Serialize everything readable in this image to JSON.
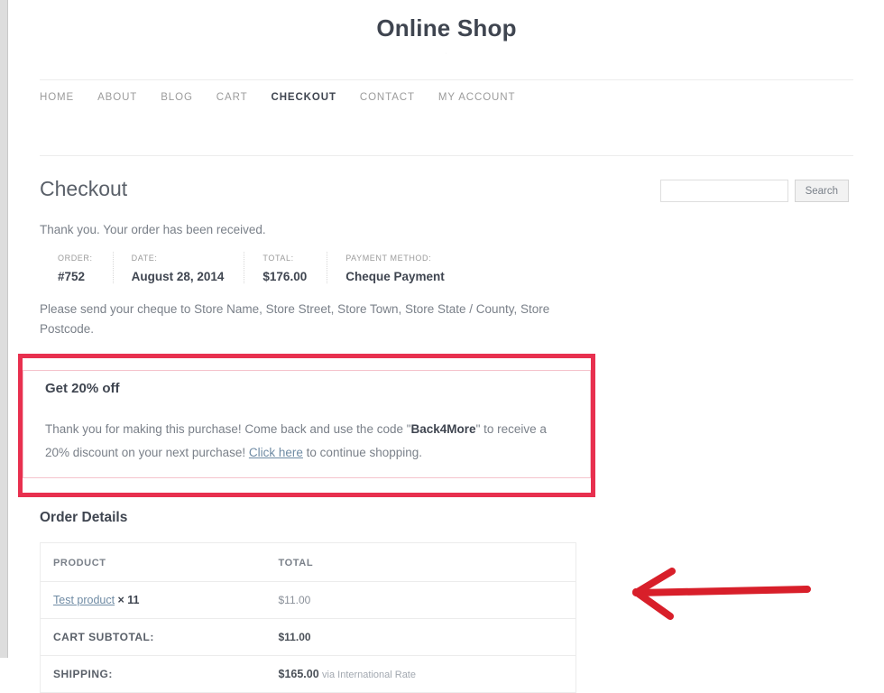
{
  "site": {
    "title": "Online Shop"
  },
  "nav": {
    "items": [
      {
        "label": "HOME",
        "active": false
      },
      {
        "label": "ABOUT",
        "active": false
      },
      {
        "label": "BLOG",
        "active": false
      },
      {
        "label": "CART",
        "active": false
      },
      {
        "label": "CHECKOUT",
        "active": true
      },
      {
        "label": "CONTACT",
        "active": false
      },
      {
        "label": "MY ACCOUNT",
        "active": false
      }
    ]
  },
  "search": {
    "value": "",
    "placeholder": "",
    "button_label": "Search"
  },
  "checkout": {
    "page_title": "Checkout",
    "thank_you": "Thank you. Your order has been received.",
    "summary": [
      {
        "label": "ORDER:",
        "value": "#752"
      },
      {
        "label": "DATE:",
        "value": "August 28, 2014"
      },
      {
        "label": "TOTAL:",
        "value": "$176.00"
      },
      {
        "label": "PAYMENT METHOD:",
        "value": "Cheque Payment"
      }
    ],
    "cheque_note": "Please send your cheque to Store Name, Store Street, Store Town, Store State / County, Store Postcode."
  },
  "promo": {
    "title": "Get 20% off",
    "text_before_code": "Thank you for making this purchase! Come back and use the code \"",
    "code": "Back4More",
    "text_after_code": "\" to receive a 20% discount on your next purchase! ",
    "link_label": "Click here",
    "text_tail": " to continue shopping.",
    "border_color": "#e8304f"
  },
  "annotation": {
    "arrow_color": "#d81f2a",
    "arrow_direction": "left"
  },
  "order_details": {
    "heading": "Order Details",
    "columns": [
      "PRODUCT",
      "TOTAL"
    ],
    "rows": [
      {
        "type": "product",
        "product_name": "Test product",
        "quantity": "× 11",
        "total": "$11.00"
      },
      {
        "type": "summary",
        "label": "CART SUBTOTAL:",
        "total": "$11.00"
      },
      {
        "type": "summary",
        "label": "SHIPPING:",
        "total": "$165.00",
        "note": "via International Rate"
      }
    ]
  }
}
